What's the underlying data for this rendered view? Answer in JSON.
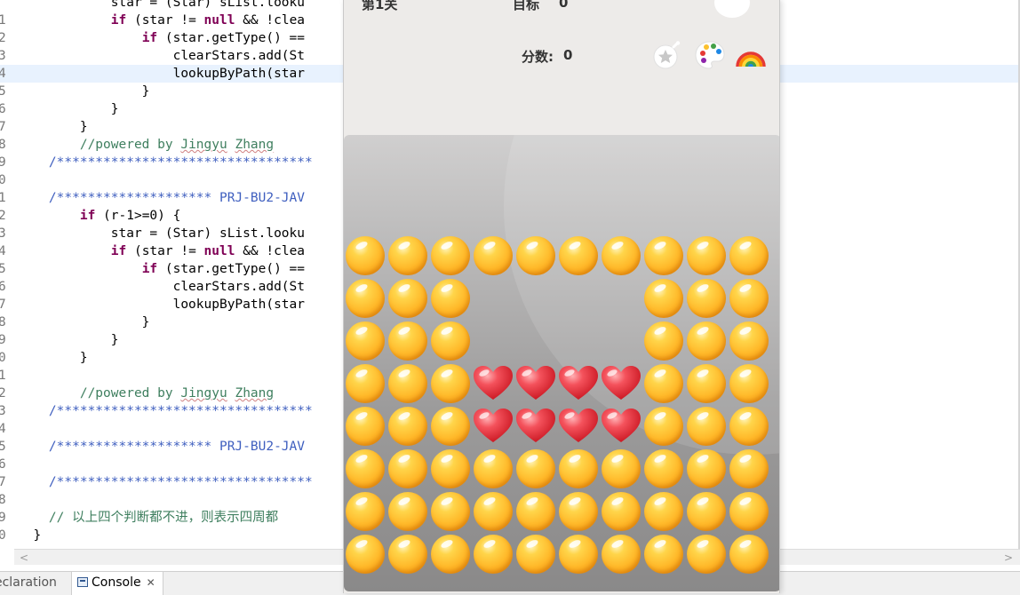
{
  "editor": {
    "lines": [
      {
        "n": "",
        "tokens": [
          {
            "t": "            star = (Star) sList.looku",
            "c": ""
          }
        ]
      },
      {
        "n": "1",
        "tokens": [
          {
            "t": "            ",
            "c": ""
          },
          {
            "t": "if",
            "c": "kw"
          },
          {
            "t": " (star != ",
            "c": ""
          },
          {
            "t": "null",
            "c": "kw"
          },
          {
            "t": " && !clea",
            "c": ""
          }
        ]
      },
      {
        "n": "2",
        "tokens": [
          {
            "t": "                ",
            "c": ""
          },
          {
            "t": "if",
            "c": "kw"
          },
          {
            "t": " (star.getType() ==",
            "c": ""
          }
        ]
      },
      {
        "n": "3",
        "tokens": [
          {
            "t": "                    clearStars.add(St",
            "c": ""
          }
        ]
      },
      {
        "n": "4",
        "hl": true,
        "tokens": [
          {
            "t": "                    lookupByPath(star",
            "c": ""
          }
        ]
      },
      {
        "n": "5",
        "tokens": [
          {
            "t": "                }",
            "c": ""
          }
        ]
      },
      {
        "n": "6",
        "tokens": [
          {
            "t": "            }",
            "c": ""
          }
        ]
      },
      {
        "n": "7",
        "tokens": [
          {
            "t": "        }",
            "c": ""
          }
        ]
      },
      {
        "n": "8",
        "tokens": [
          {
            "t": "        ",
            "c": ""
          },
          {
            "t": "//powered by ",
            "c": "cm"
          },
          {
            "t": "Jingyu",
            "c": "cm sq"
          },
          {
            "t": " ",
            "c": "cm"
          },
          {
            "t": "Zhang",
            "c": "cm sq"
          }
        ]
      },
      {
        "n": "9",
        "tokens": [
          {
            "t": "    /*********************************",
            "c": "cb"
          }
        ]
      },
      {
        "n": "0",
        "tokens": []
      },
      {
        "n": "1",
        "tokens": [
          {
            "t": "    /******************** PRJ-BU2-JAV",
            "c": "cb"
          }
        ]
      },
      {
        "n": "2",
        "tokens": [
          {
            "t": "        ",
            "c": ""
          },
          {
            "t": "if",
            "c": "kw"
          },
          {
            "t": " (r-1>=0) {",
            "c": ""
          }
        ]
      },
      {
        "n": "3",
        "tokens": [
          {
            "t": "            star = (Star) sList.looku",
            "c": ""
          }
        ]
      },
      {
        "n": "4",
        "tokens": [
          {
            "t": "            ",
            "c": ""
          },
          {
            "t": "if",
            "c": "kw"
          },
          {
            "t": " (star != ",
            "c": ""
          },
          {
            "t": "null",
            "c": "kw"
          },
          {
            "t": " && !clea",
            "c": ""
          }
        ]
      },
      {
        "n": "5",
        "tokens": [
          {
            "t": "                ",
            "c": ""
          },
          {
            "t": "if",
            "c": "kw"
          },
          {
            "t": " (star.getType() ==",
            "c": ""
          }
        ]
      },
      {
        "n": "6",
        "tokens": [
          {
            "t": "                    clearStars.add(St",
            "c": ""
          }
        ]
      },
      {
        "n": "7",
        "tokens": [
          {
            "t": "                    lookupByPath(star",
            "c": ""
          }
        ]
      },
      {
        "n": "8",
        "tokens": [
          {
            "t": "                }",
            "c": ""
          }
        ]
      },
      {
        "n": "9",
        "tokens": [
          {
            "t": "            }",
            "c": ""
          }
        ]
      },
      {
        "n": "0",
        "tokens": [
          {
            "t": "        }",
            "c": ""
          }
        ]
      },
      {
        "n": "1",
        "tokens": []
      },
      {
        "n": "2",
        "tokens": [
          {
            "t": "        ",
            "c": ""
          },
          {
            "t": "//powered by ",
            "c": "cm"
          },
          {
            "t": "Jingyu",
            "c": "cm sq"
          },
          {
            "t": " ",
            "c": "cm"
          },
          {
            "t": "Zhang",
            "c": "cm sq"
          }
        ]
      },
      {
        "n": "3",
        "tokens": [
          {
            "t": "    /*********************************",
            "c": "cb"
          }
        ]
      },
      {
        "n": "4",
        "tokens": []
      },
      {
        "n": "5",
        "tokens": [
          {
            "t": "    /******************** PRJ-BU2-JAV",
            "c": "cb"
          }
        ]
      },
      {
        "n": "6",
        "tokens": []
      },
      {
        "n": "7",
        "tokens": [
          {
            "t": "    /*********************************",
            "c": "cb"
          }
        ]
      },
      {
        "n": "8",
        "tokens": []
      },
      {
        "n": "9",
        "tokens": [
          {
            "t": "    // 以上四个判断都不进，则表示四周都",
            "c": "cm"
          }
        ]
      },
      {
        "n": "0",
        "tokens": [
          {
            "t": "  }",
            "c": ""
          }
        ]
      }
    ]
  },
  "tabs": {
    "declaration": "eclaration",
    "console": "Console",
    "console_close": "✕"
  },
  "scroll": {
    "left_arrow": "<",
    "right_arrow": ">"
  },
  "game": {
    "level": "第1关",
    "target_label": "目标",
    "target_value": "0",
    "score_label": "分数:",
    "score_value": "0",
    "icons": {
      "cloud": "cloud-icon",
      "bomb": "star-bomb-icon",
      "palette": "palette-icon",
      "rainbow": "rainbow-icon"
    },
    "colors": {
      "star": "#ffb92a",
      "heart": "#e8323c",
      "board": "#a5a4a4"
    },
    "grid": [
      "OOOOOOOOOO",
      "OOO....OOO",
      "OOO....OOO",
      "OOOHHHHOOO",
      "OOOHHHHOOO",
      "OOOOOOOOOO",
      "OOOOOOOOOO",
      "OOOOOOOOOO"
    ]
  }
}
